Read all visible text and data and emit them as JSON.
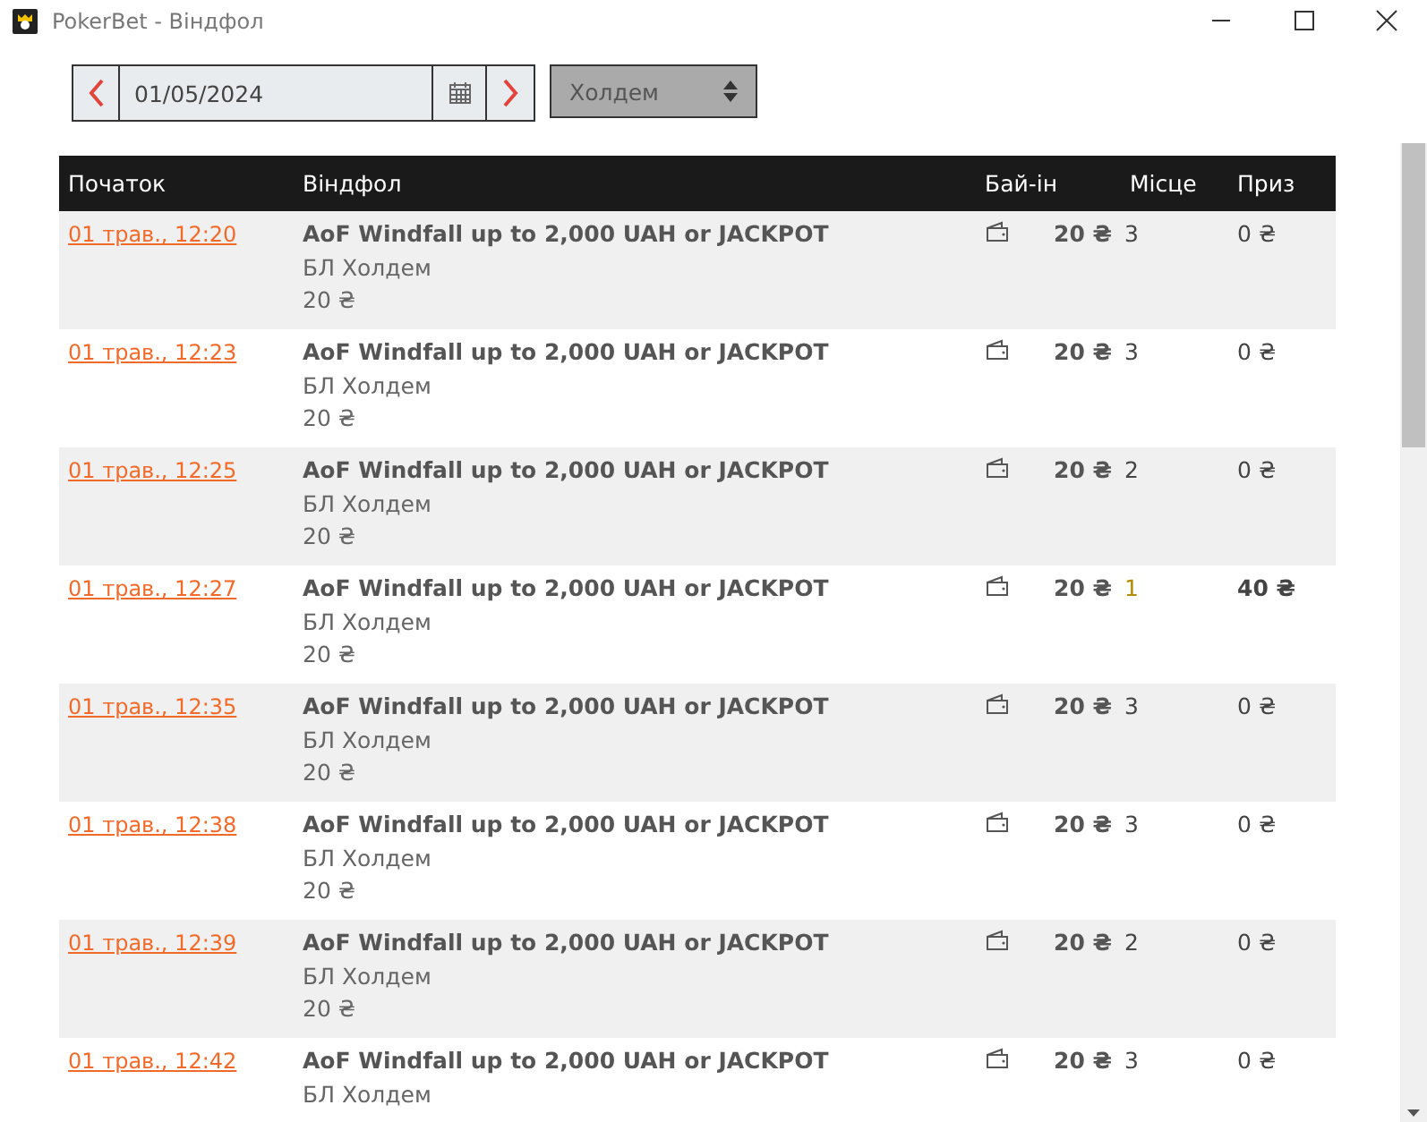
{
  "window": {
    "title": "PokerBet - Віндфол"
  },
  "filter": {
    "date": "01/05/2024",
    "game": "Холдем"
  },
  "table": {
    "columns": [
      "Початок",
      "Віндфол",
      "Бай-ін",
      "Місце",
      "Приз"
    ],
    "rows": [
      {
        "start": "01 трав., 12:20",
        "title": "AoF Windfall up to 2,000 UAH or JACKPOT",
        "game": "БЛ Холдем",
        "amount": "20 ₴",
        "buyin": "20 ₴",
        "place": "3",
        "prize": "0 ₴",
        "won": false
      },
      {
        "start": "01 трав., 12:23",
        "title": "AoF Windfall up to 2,000 UAH or JACKPOT",
        "game": "БЛ Холдем",
        "amount": "20 ₴",
        "buyin": "20 ₴",
        "place": "3",
        "prize": "0 ₴",
        "won": false
      },
      {
        "start": "01 трав., 12:25",
        "title": "AoF Windfall up to 2,000 UAH or JACKPOT",
        "game": "БЛ Холдем",
        "amount": "20 ₴",
        "buyin": "20 ₴",
        "place": "2",
        "prize": "0 ₴",
        "won": false
      },
      {
        "start": "01 трав., 12:27",
        "title": "AoF Windfall up to 2,000 UAH or JACKPOT",
        "game": "БЛ Холдем",
        "amount": "20 ₴",
        "buyin": "20 ₴",
        "place": "1",
        "prize": "40 ₴",
        "won": true
      },
      {
        "start": "01 трав., 12:35",
        "title": "AoF Windfall up to 2,000 UAH or JACKPOT",
        "game": "БЛ Холдем",
        "amount": "20 ₴",
        "buyin": "20 ₴",
        "place": "3",
        "prize": "0 ₴",
        "won": false
      },
      {
        "start": "01 трав., 12:38",
        "title": "AoF Windfall up to 2,000 UAH or JACKPOT",
        "game": "БЛ Холдем",
        "amount": "20 ₴",
        "buyin": "20 ₴",
        "place": "3",
        "prize": "0 ₴",
        "won": false
      },
      {
        "start": "01 трав., 12:39",
        "title": "AoF Windfall up to 2,000 UAH or JACKPOT",
        "game": "БЛ Холдем",
        "amount": "20 ₴",
        "buyin": "20 ₴",
        "place": "2",
        "prize": "0 ₴",
        "won": false
      },
      {
        "start": "01 трав., 12:42",
        "title": "AoF Windfall up to 2,000 UAH or JACKPOT",
        "game": "БЛ Холдем",
        "buyin": "20 ₴",
        "place": "3",
        "prize": "0 ₴",
        "won": false
      }
    ]
  }
}
